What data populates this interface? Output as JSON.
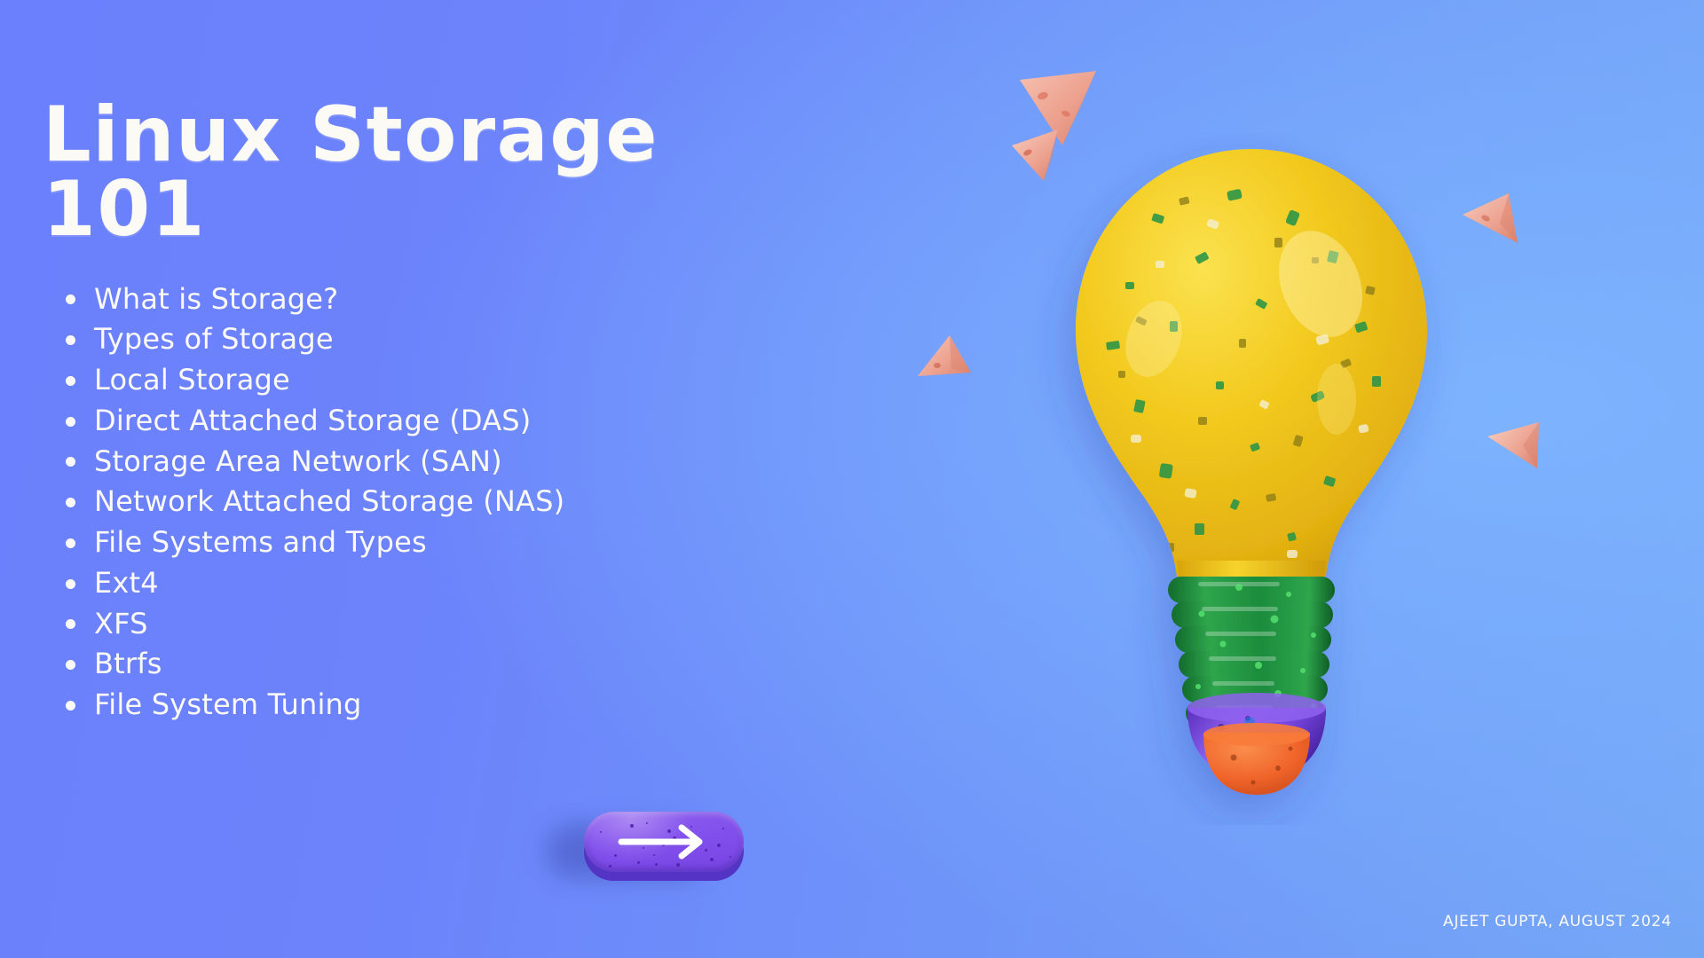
{
  "slide": {
    "title": "Linux Storage\n101",
    "agenda": [
      "What is Storage?",
      "Types of Storage",
      "Local Storage",
      "Direct Attached Storage (DAS)",
      "Storage Area Network (SAN)",
      "Network Attached Storage (NAS)",
      "File Systems and Types",
      "Ext4",
      "XFS",
      "Btrfs",
      "File System Tuning"
    ],
    "next_button": {
      "icon": "arrow-right-icon",
      "label": ""
    },
    "credit": "Ajeet Gupta, August 2024",
    "illustration": {
      "name": "light-bulb-3d",
      "decorations": "pink-cones"
    }
  },
  "colors": {
    "background_left": "#6B80FC",
    "background_right": "#74A6F6",
    "text": "#FBFAF6",
    "button_face": "#8351EC",
    "button_shadow": "#5334C4",
    "bulb_glass": "#F2C21C",
    "bulb_threads": "#1E8A3C",
    "bulb_collar": "#6C3FD6",
    "bulb_tip": "#F0652A",
    "cone": "#EDA18E"
  }
}
